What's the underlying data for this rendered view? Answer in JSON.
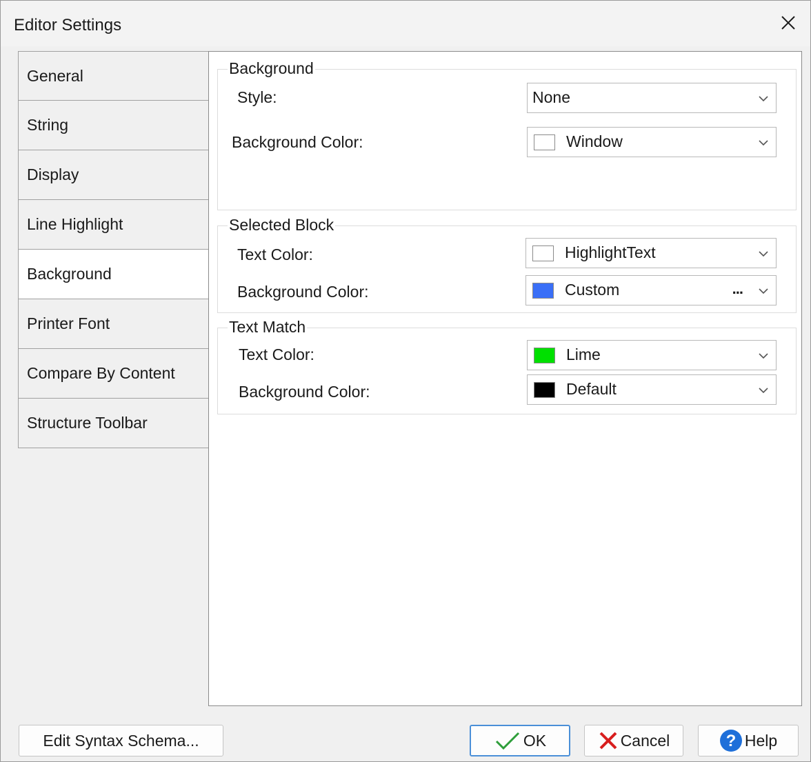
{
  "window": {
    "title": "Editor Settings"
  },
  "sidebar": {
    "items": [
      {
        "label": "General"
      },
      {
        "label": "String"
      },
      {
        "label": "Display"
      },
      {
        "label": "Line Highlight"
      },
      {
        "label": "Background",
        "selected": true
      },
      {
        "label": "Printer Font"
      },
      {
        "label": "Compare By Content"
      },
      {
        "label": "Structure Toolbar"
      }
    ]
  },
  "groups": {
    "background": {
      "title": "Background",
      "style_label": "Style:",
      "style_value": "None",
      "bgcolor_label": "Background Color:",
      "bgcolor_value": "Window",
      "bgcolor_swatch": "#ffffff"
    },
    "selected_block": {
      "title": "Selected Block",
      "textcolor_label": "Text Color:",
      "textcolor_value": "HighlightText",
      "textcolor_swatch": "#ffffff",
      "bgcolor_label": "Background Color:",
      "bgcolor_value": "Custom",
      "bgcolor_swatch": "#3a6ff7",
      "more": "..."
    },
    "text_match": {
      "title": "Text Match",
      "textcolor_label": "Text Color:",
      "textcolor_value": "Lime",
      "textcolor_swatch": "#00e000",
      "bgcolor_label": "Background Color:",
      "bgcolor_value": "Default",
      "bgcolor_swatch": "#000000"
    }
  },
  "buttons": {
    "edit_schema": "Edit Syntax Schema...",
    "ok": "OK",
    "cancel": "Cancel",
    "help": "Help"
  },
  "icons": {
    "close": "close-icon",
    "chevron": "chevron-down-icon",
    "check": "check-icon",
    "cancel": "cancel-x-icon",
    "help": "help-question-icon"
  },
  "colors": {
    "ok_check": "#2e9e3a",
    "cancel_x": "#d81e1e",
    "help_circle": "#1e6fd9",
    "default_button_border": "#4a8fd8"
  }
}
